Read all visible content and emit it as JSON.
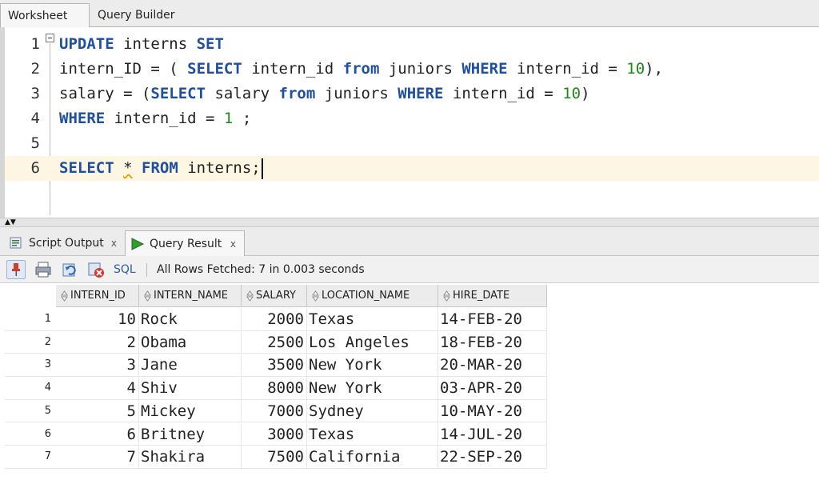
{
  "tabs": {
    "worksheet": "Worksheet",
    "query_builder": "Query Builder"
  },
  "editor": {
    "line_numbers": [
      "1",
      "2",
      "3",
      "4",
      "5",
      "6"
    ],
    "line1": {
      "kw1": "UPDATE",
      "t1": " interns ",
      "kw2": "SET"
    },
    "line2": {
      "t1": "intern_ID = ( ",
      "kw1": "SELECT",
      "t2": " intern_id ",
      "kw2": "from",
      "t3": " juniors ",
      "kw3": "WHERE",
      "t4": " intern_id = ",
      "n1": "10",
      "t5": "),"
    },
    "line3": {
      "t1": "salary = (",
      "kw1": "SELECT",
      "t2": " salary ",
      "kw2": "from",
      "t3": " juniors ",
      "kw3": "WHERE",
      "t4": " intern_id = ",
      "n1": "10",
      "t5": ")"
    },
    "line4": {
      "kw1": "WHERE",
      "t1": " intern_id = ",
      "n1": "1",
      "t2": " ;"
    },
    "line6": {
      "kw1": "SELECT",
      "t1": " ",
      "star": "*",
      "t2": " ",
      "kw2": "FROM",
      "t3": " interns;"
    }
  },
  "output_tabs": {
    "script_output": "Script Output",
    "query_result": "Query Result",
    "close": "x"
  },
  "toolbar": {
    "sql_label": "SQL",
    "status": "All Rows Fetched: 7 in 0.003 seconds"
  },
  "grid": {
    "columns": [
      "INTERN_ID",
      "INTERN_NAME",
      "SALARY",
      "LOCATION_NAME",
      "HIRE_DATE"
    ],
    "rows": [
      {
        "n": "1",
        "id": "10",
        "name": "Rock",
        "salary": "2000",
        "location": "Texas",
        "hire": "14-FEB-20"
      },
      {
        "n": "2",
        "id": "2",
        "name": "Obama",
        "salary": "2500",
        "location": "Los Angeles",
        "hire": "18-FEB-20"
      },
      {
        "n": "3",
        "id": "3",
        "name": "Jane",
        "salary": "3500",
        "location": "New York",
        "hire": "20-MAR-20"
      },
      {
        "n": "4",
        "id": "4",
        "name": "Shiv",
        "salary": "8000",
        "location": "New York",
        "hire": "03-APR-20"
      },
      {
        "n": "5",
        "id": "5",
        "name": "Mickey",
        "salary": "7000",
        "location": "Sydney",
        "hire": "10-MAY-20"
      },
      {
        "n": "6",
        "id": "6",
        "name": "Britney",
        "salary": "3000",
        "location": "Texas",
        "hire": "14-JUL-20"
      },
      {
        "n": "7",
        "id": "7",
        "name": "Shakira",
        "salary": "7500",
        "location": "California",
        "hire": "22-SEP-20"
      }
    ]
  },
  "colors": {
    "keyword": "#1f4f9e",
    "number": "#1a8a1a",
    "current_line": "#fdf6e3",
    "play_icon": "#2e9e2e"
  }
}
